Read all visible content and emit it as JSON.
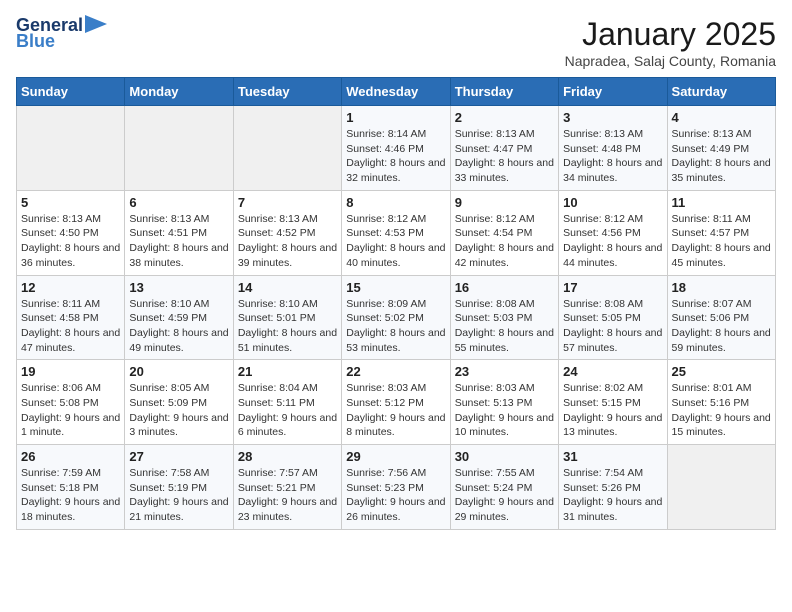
{
  "header": {
    "logo_line1": "General",
    "logo_line2": "Blue",
    "title": "January 2025",
    "subtitle": "Napradea, Salaj County, Romania"
  },
  "weekdays": [
    "Sunday",
    "Monday",
    "Tuesday",
    "Wednesday",
    "Thursday",
    "Friday",
    "Saturday"
  ],
  "weeks": [
    [
      {
        "day": "",
        "info": ""
      },
      {
        "day": "",
        "info": ""
      },
      {
        "day": "",
        "info": ""
      },
      {
        "day": "1",
        "info": "Sunrise: 8:14 AM\nSunset: 4:46 PM\nDaylight: 8 hours\nand 32 minutes."
      },
      {
        "day": "2",
        "info": "Sunrise: 8:13 AM\nSunset: 4:47 PM\nDaylight: 8 hours\nand 33 minutes."
      },
      {
        "day": "3",
        "info": "Sunrise: 8:13 AM\nSunset: 4:48 PM\nDaylight: 8 hours\nand 34 minutes."
      },
      {
        "day": "4",
        "info": "Sunrise: 8:13 AM\nSunset: 4:49 PM\nDaylight: 8 hours\nand 35 minutes."
      }
    ],
    [
      {
        "day": "5",
        "info": "Sunrise: 8:13 AM\nSunset: 4:50 PM\nDaylight: 8 hours\nand 36 minutes."
      },
      {
        "day": "6",
        "info": "Sunrise: 8:13 AM\nSunset: 4:51 PM\nDaylight: 8 hours\nand 38 minutes."
      },
      {
        "day": "7",
        "info": "Sunrise: 8:13 AM\nSunset: 4:52 PM\nDaylight: 8 hours\nand 39 minutes."
      },
      {
        "day": "8",
        "info": "Sunrise: 8:12 AM\nSunset: 4:53 PM\nDaylight: 8 hours\nand 40 minutes."
      },
      {
        "day": "9",
        "info": "Sunrise: 8:12 AM\nSunset: 4:54 PM\nDaylight: 8 hours\nand 42 minutes."
      },
      {
        "day": "10",
        "info": "Sunrise: 8:12 AM\nSunset: 4:56 PM\nDaylight: 8 hours\nand 44 minutes."
      },
      {
        "day": "11",
        "info": "Sunrise: 8:11 AM\nSunset: 4:57 PM\nDaylight: 8 hours\nand 45 minutes."
      }
    ],
    [
      {
        "day": "12",
        "info": "Sunrise: 8:11 AM\nSunset: 4:58 PM\nDaylight: 8 hours\nand 47 minutes."
      },
      {
        "day": "13",
        "info": "Sunrise: 8:10 AM\nSunset: 4:59 PM\nDaylight: 8 hours\nand 49 minutes."
      },
      {
        "day": "14",
        "info": "Sunrise: 8:10 AM\nSunset: 5:01 PM\nDaylight: 8 hours\nand 51 minutes."
      },
      {
        "day": "15",
        "info": "Sunrise: 8:09 AM\nSunset: 5:02 PM\nDaylight: 8 hours\nand 53 minutes."
      },
      {
        "day": "16",
        "info": "Sunrise: 8:08 AM\nSunset: 5:03 PM\nDaylight: 8 hours\nand 55 minutes."
      },
      {
        "day": "17",
        "info": "Sunrise: 8:08 AM\nSunset: 5:05 PM\nDaylight: 8 hours\nand 57 minutes."
      },
      {
        "day": "18",
        "info": "Sunrise: 8:07 AM\nSunset: 5:06 PM\nDaylight: 8 hours\nand 59 minutes."
      }
    ],
    [
      {
        "day": "19",
        "info": "Sunrise: 8:06 AM\nSunset: 5:08 PM\nDaylight: 9 hours\nand 1 minute."
      },
      {
        "day": "20",
        "info": "Sunrise: 8:05 AM\nSunset: 5:09 PM\nDaylight: 9 hours\nand 3 minutes."
      },
      {
        "day": "21",
        "info": "Sunrise: 8:04 AM\nSunset: 5:11 PM\nDaylight: 9 hours\nand 6 minutes."
      },
      {
        "day": "22",
        "info": "Sunrise: 8:03 AM\nSunset: 5:12 PM\nDaylight: 9 hours\nand 8 minutes."
      },
      {
        "day": "23",
        "info": "Sunrise: 8:03 AM\nSunset: 5:13 PM\nDaylight: 9 hours\nand 10 minutes."
      },
      {
        "day": "24",
        "info": "Sunrise: 8:02 AM\nSunset: 5:15 PM\nDaylight: 9 hours\nand 13 minutes."
      },
      {
        "day": "25",
        "info": "Sunrise: 8:01 AM\nSunset: 5:16 PM\nDaylight: 9 hours\nand 15 minutes."
      }
    ],
    [
      {
        "day": "26",
        "info": "Sunrise: 7:59 AM\nSunset: 5:18 PM\nDaylight: 9 hours\nand 18 minutes."
      },
      {
        "day": "27",
        "info": "Sunrise: 7:58 AM\nSunset: 5:19 PM\nDaylight: 9 hours\nand 21 minutes."
      },
      {
        "day": "28",
        "info": "Sunrise: 7:57 AM\nSunset: 5:21 PM\nDaylight: 9 hours\nand 23 minutes."
      },
      {
        "day": "29",
        "info": "Sunrise: 7:56 AM\nSunset: 5:23 PM\nDaylight: 9 hours\nand 26 minutes."
      },
      {
        "day": "30",
        "info": "Sunrise: 7:55 AM\nSunset: 5:24 PM\nDaylight: 9 hours\nand 29 minutes."
      },
      {
        "day": "31",
        "info": "Sunrise: 7:54 AM\nSunset: 5:26 PM\nDaylight: 9 hours\nand 31 minutes."
      },
      {
        "day": "",
        "info": ""
      }
    ]
  ]
}
